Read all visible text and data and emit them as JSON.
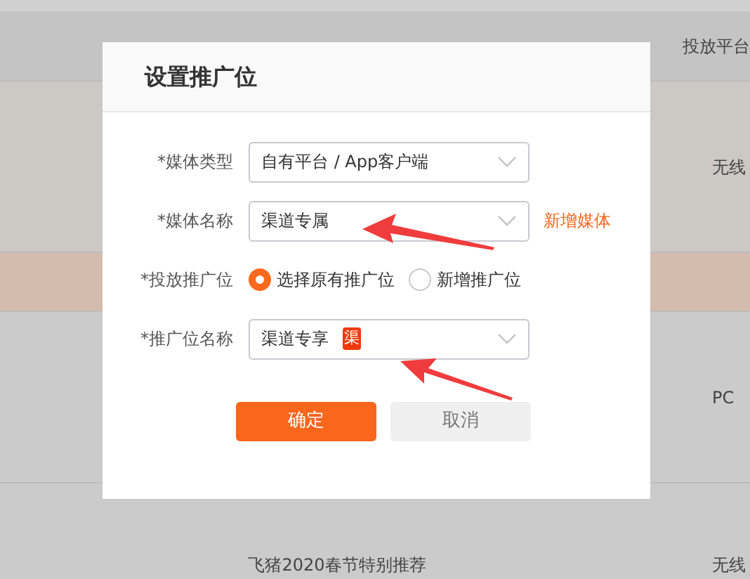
{
  "table": {
    "columns": [
      {
        "label": "投放平台"
      }
    ],
    "rows": [
      {
        "platform": "无线",
        "selected": false
      },
      {
        "platform": "",
        "selected": true
      },
      {
        "platform": "PC",
        "selected": false
      },
      {
        "activity": "飞猪2020春节特别推荐",
        "platform": "无线",
        "selected": false
      }
    ]
  },
  "dialog": {
    "title": "设置推广位",
    "fields": [
      {
        "kind": "select",
        "label": "*媒体类型",
        "value": "自有平台 / App客户端"
      },
      {
        "kind": "select",
        "label": "*媒体名称",
        "value": "渠道专属",
        "link": "新增媒体"
      },
      {
        "kind": "radio",
        "label": "*投放推广位",
        "options": [
          {
            "label": "选择原有推广位",
            "selected": true
          },
          {
            "label": "新增推广位",
            "selected": false
          }
        ]
      },
      {
        "kind": "select",
        "label": "*推广位名称",
        "value": "渠道专享",
        "tag": "渠"
      }
    ],
    "buttons": [
      {
        "kind": "primary",
        "label": "确定"
      },
      {
        "kind": "secondary",
        "label": "取消"
      }
    ]
  }
}
